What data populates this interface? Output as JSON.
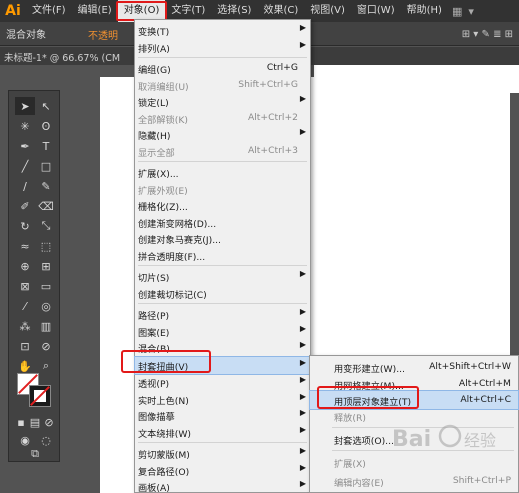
{
  "app": {
    "logo": "Ai"
  },
  "menubar": {
    "items": [
      "文件(F)",
      "编辑(E)",
      "对象(O)",
      "文字(T)",
      "选择(S)",
      "效果(C)",
      "视图(V)",
      "窗口(W)",
      "帮助(H)"
    ],
    "active_index": 2
  },
  "controlbar": {
    "label": "混合对象",
    "opacity_label": "不透明",
    "right_text": "⊞ ▾ ✎ ≣ ⊞"
  },
  "document": {
    "tab_title": "未标题-1* @ 66.67% (CM"
  },
  "object_menu": {
    "items": [
      {
        "label": "变换(T)",
        "shortcut": "",
        "submenu": true,
        "disabled": false
      },
      {
        "label": "排列(A)",
        "shortcut": "",
        "submenu": true,
        "disabled": false
      },
      {
        "label": "编组(G)",
        "shortcut": "Ctrl+G",
        "submenu": false,
        "disabled": false
      },
      {
        "label": "取消编组(U)",
        "shortcut": "Shift+Ctrl+G",
        "submenu": false,
        "disabled": true
      },
      {
        "label": "锁定(L)",
        "shortcut": "",
        "submenu": true,
        "disabled": false
      },
      {
        "label": "全部解锁(K)",
        "shortcut": "Alt+Ctrl+2",
        "submenu": false,
        "disabled": true
      },
      {
        "label": "隐藏(H)",
        "shortcut": "",
        "submenu": true,
        "disabled": false
      },
      {
        "label": "显示全部",
        "shortcut": "Alt+Ctrl+3",
        "submenu": false,
        "disabled": true
      },
      {
        "label": "扩展(X)...",
        "shortcut": "",
        "submenu": false,
        "disabled": false
      },
      {
        "label": "扩展外观(E)",
        "shortcut": "",
        "submenu": false,
        "disabled": true
      },
      {
        "label": "栅格化(Z)...",
        "shortcut": "",
        "submenu": false,
        "disabled": false
      },
      {
        "label": "创建渐变网格(D)...",
        "shortcut": "",
        "submenu": false,
        "disabled": false
      },
      {
        "label": "创建对象马赛克(J)...",
        "shortcut": "",
        "submenu": false,
        "disabled": false
      },
      {
        "label": "拼合透明度(F)...",
        "shortcut": "",
        "submenu": false,
        "disabled": false
      },
      {
        "label": "切片(S)",
        "shortcut": "",
        "submenu": true,
        "disabled": false
      },
      {
        "label": "创建裁切标记(C)",
        "shortcut": "",
        "submenu": false,
        "disabled": false
      },
      {
        "label": "路径(P)",
        "shortcut": "",
        "submenu": true,
        "disabled": false
      },
      {
        "label": "图案(E)",
        "shortcut": "",
        "submenu": true,
        "disabled": false
      },
      {
        "label": "混合(B)",
        "shortcut": "",
        "submenu": true,
        "disabled": false
      },
      {
        "label": "封套扭曲(V)",
        "shortcut": "",
        "submenu": true,
        "disabled": false,
        "highlighted": true
      },
      {
        "label": "透视(P)",
        "shortcut": "",
        "submenu": true,
        "disabled": false
      },
      {
        "label": "实时上色(N)",
        "shortcut": "",
        "submenu": true,
        "disabled": false
      },
      {
        "label": "图像描摹",
        "shortcut": "",
        "submenu": true,
        "disabled": false
      },
      {
        "label": "文本绕排(W)",
        "shortcut": "",
        "submenu": true,
        "disabled": false
      },
      {
        "label": "剪切蒙版(M)",
        "shortcut": "",
        "submenu": true,
        "disabled": false
      },
      {
        "label": "复合路径(O)",
        "shortcut": "",
        "submenu": true,
        "disabled": false
      },
      {
        "label": "画板(A)",
        "shortcut": "",
        "submenu": true,
        "disabled": false
      }
    ]
  },
  "envelope_submenu": {
    "items": [
      {
        "label": "用变形建立(W)...",
        "shortcut": "Alt+Shift+Ctrl+W",
        "disabled": false
      },
      {
        "label": "用网格建立(M)...",
        "shortcut": "Alt+Ctrl+M",
        "disabled": false
      },
      {
        "label": "用顶层对象建立(T)",
        "shortcut": "Alt+Ctrl+C",
        "disabled": false,
        "highlighted": true
      },
      {
        "label": "释放(R)",
        "shortcut": "",
        "disabled": true
      },
      {
        "label": "封套选项(O)...",
        "shortcut": "",
        "disabled": false
      },
      {
        "label": "扩展(X)",
        "shortcut": "",
        "disabled": true
      },
      {
        "label": "编辑内容(E)",
        "shortcut": "Shift+Ctrl+P",
        "disabled": true
      }
    ]
  },
  "colors": {
    "accent": "#ff9a00",
    "annotation": "#e21919",
    "highlight": "#c8ddf4"
  },
  "watermark": {
    "text": "Bai 经验"
  }
}
